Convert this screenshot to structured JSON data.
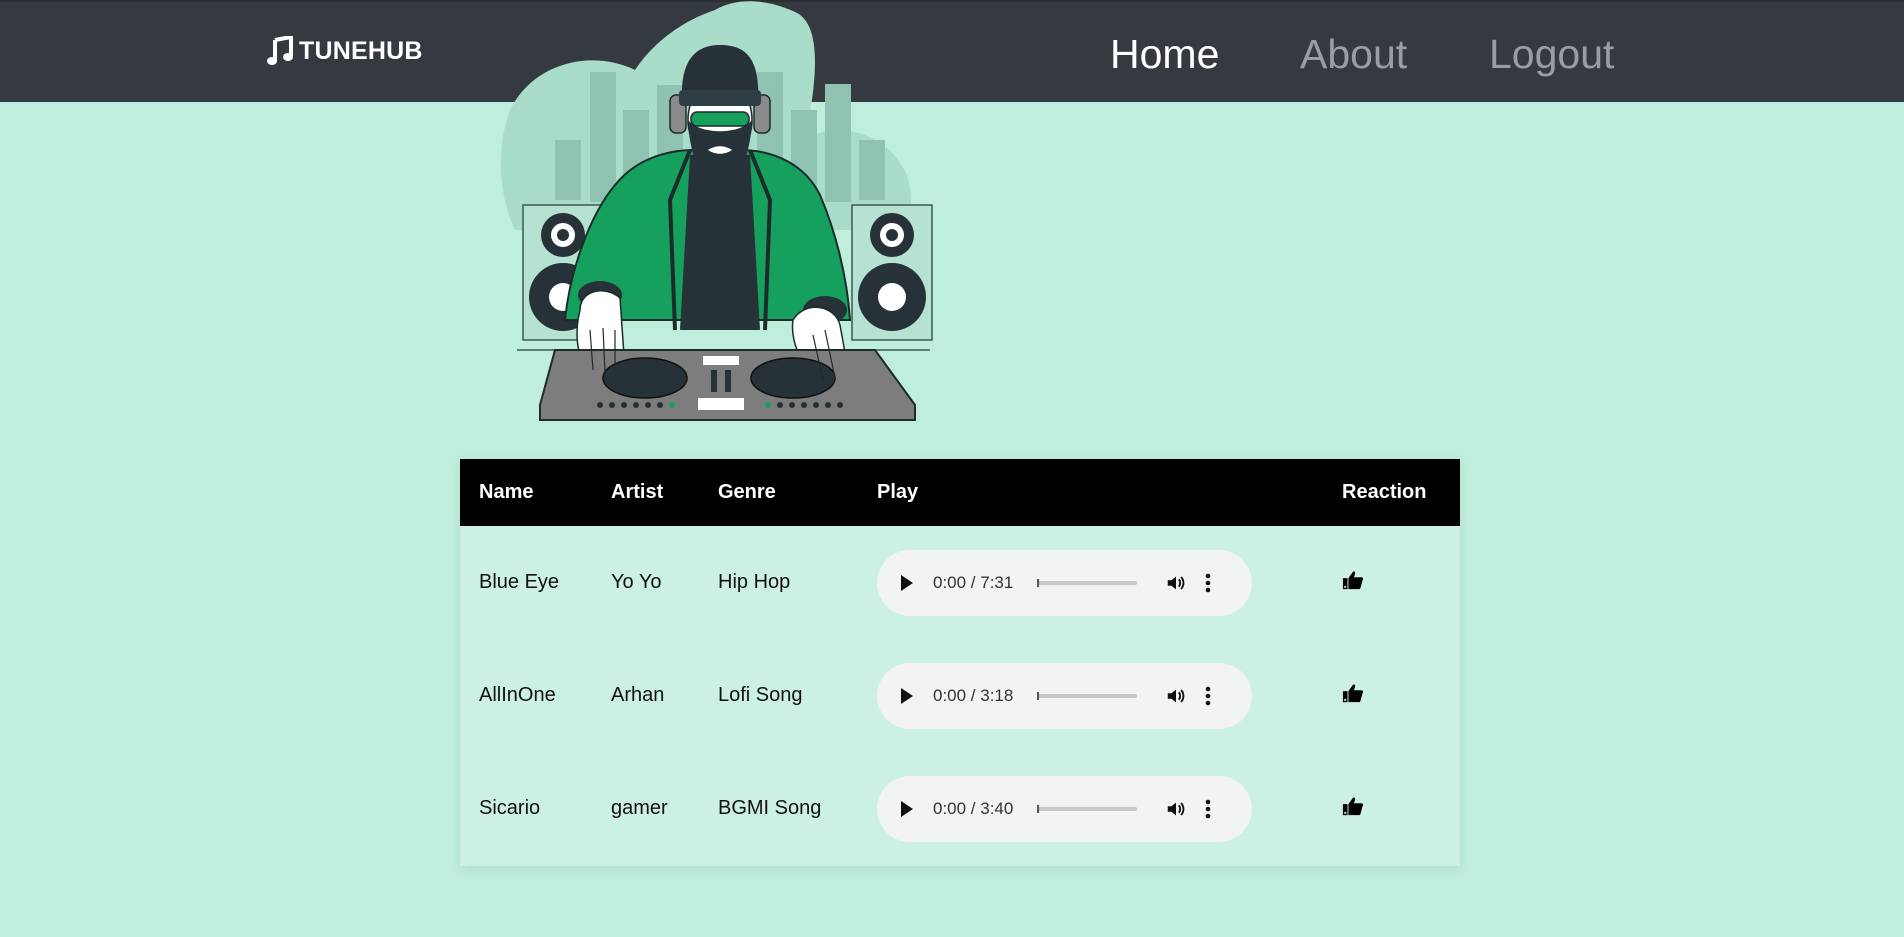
{
  "brand": {
    "name": "TUNEHUB"
  },
  "nav": {
    "home": "Home",
    "about": "About",
    "logout": "Logout"
  },
  "colors": {
    "background": "#c0eedc",
    "navbar": "#343a40",
    "table_header": "#000000",
    "table_body": "#cdf0e4",
    "jacket_green": "#15a05d"
  },
  "table": {
    "headers": {
      "name": "Name",
      "artist": "Artist",
      "genre": "Genre",
      "play": "Play",
      "reaction": "Reaction"
    },
    "rows": [
      {
        "name": "Blue Eye",
        "artist": "Yo Yo",
        "genre": "Hip Hop",
        "time": "0:00 / 7:31",
        "reaction_icon": "thumbs-up-icon"
      },
      {
        "name": "AllInOne",
        "artist": "Arhan",
        "genre": "Lofi Song",
        "time": "0:00 / 3:18",
        "reaction_icon": "thumbs-up-icon"
      },
      {
        "name": "Sicario",
        "artist": "gamer",
        "genre": "BGMI Song",
        "time": "0:00 / 3:40",
        "reaction_icon": "thumbs-up-icon"
      }
    ]
  },
  "icons": {
    "brand": "music-note-icon",
    "hero": "dj-illustration",
    "play": "play-icon",
    "volume": "volume-icon",
    "more": "more-options-icon"
  }
}
